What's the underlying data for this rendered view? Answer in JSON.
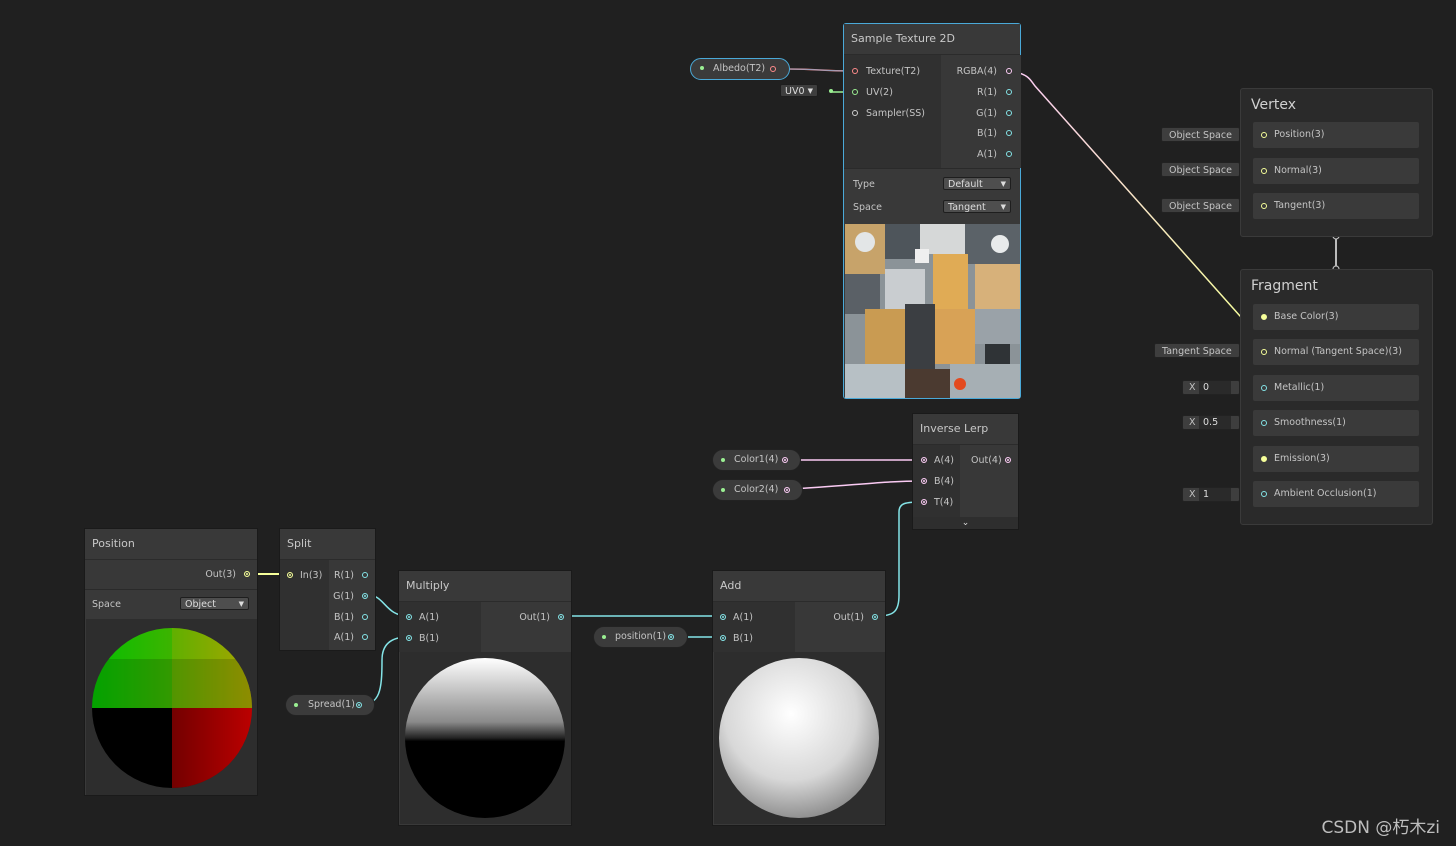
{
  "colors": {
    "vector3": "#f6ff9a",
    "vector4": "#fbcbf4",
    "vector1": "#84e4e7",
    "texture": "#ff8b8b",
    "sampler": "#9e9e9e",
    "vector2": "#9aef92",
    "selection": "#4aa9d8"
  },
  "sample_texture": {
    "title": "Sample Texture 2D",
    "inputs": [
      "Texture(T2)",
      "UV(2)",
      "Sampler(SS)"
    ],
    "outputs": [
      "RGBA(4)",
      "R(1)",
      "G(1)",
      "B(1)",
      "A(1)"
    ],
    "type_label": "Type",
    "type_value": "Default",
    "space_label": "Space",
    "space_value": "Tangent"
  },
  "albedo_pill": "Albedo(T2)",
  "uv_dropdown": "UV0",
  "vertex": {
    "title": "Vertex",
    "slots": [
      "Position(3)",
      "Normal(3)",
      "Tangent(3)"
    ],
    "tags": [
      "Object Space",
      "Object Space",
      "Object Space"
    ]
  },
  "fragment": {
    "title": "Fragment",
    "slots": [
      "Base Color(3)",
      "Normal (Tangent Space)(3)",
      "Metallic(1)",
      "Smoothness(1)",
      "Emission(3)",
      "Ambient Occlusion(1)"
    ],
    "normal_tag": "Tangent Space",
    "metallic_value": "0",
    "smoothness_value": "0.5",
    "ao_value": "1",
    "x_label": "X"
  },
  "inverse_lerp": {
    "title": "Inverse Lerp",
    "inputs": [
      "A(4)",
      "B(4)",
      "T(4)"
    ],
    "output": "Out(4)"
  },
  "color1_pill": "Color1(4)",
  "color2_pill": "Color2(4)",
  "position_node": {
    "title": "Position",
    "output": "Out(3)",
    "space_label": "Space",
    "space_value": "Object"
  },
  "split_node": {
    "title": "Split",
    "input": "In(3)",
    "outputs": [
      "R(1)",
      "G(1)",
      "B(1)",
      "A(1)"
    ]
  },
  "multiply_node": {
    "title": "Multiply",
    "inputs": [
      "A(1)",
      "B(1)"
    ],
    "output": "Out(1)"
  },
  "add_node": {
    "title": "Add",
    "inputs": [
      "A(1)",
      "B(1)"
    ],
    "output": "Out(1)"
  },
  "spread_pill": "Spread(1)",
  "position_pill": "position(1)",
  "watermark": "CSDN @朽木zi"
}
